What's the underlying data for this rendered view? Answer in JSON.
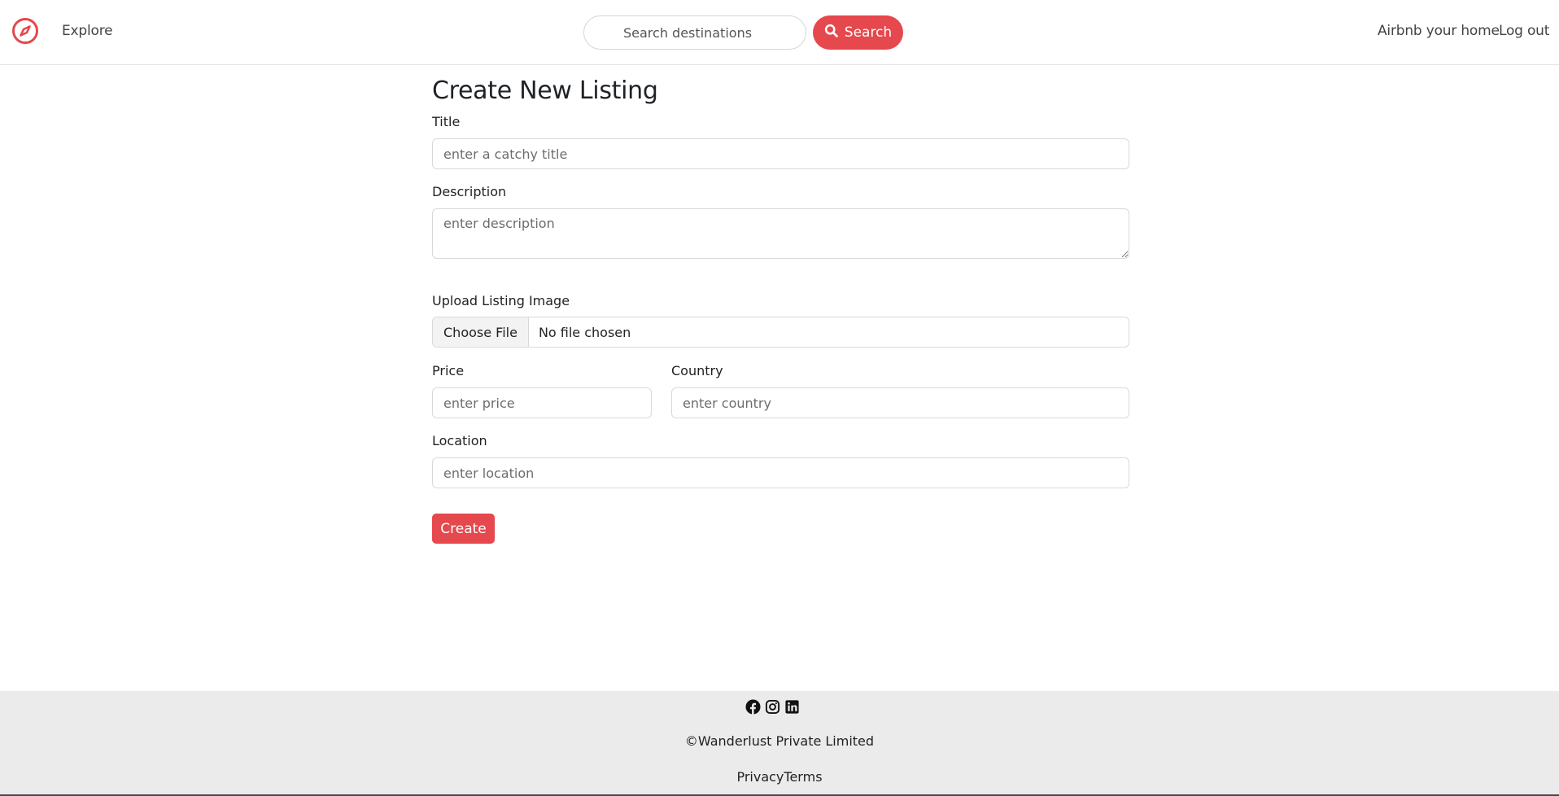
{
  "navbar": {
    "explore_label": "Explore",
    "search_placeholder": "Search destinations",
    "search_button_label": "Search",
    "host_label": "Airbnb your home",
    "logout_label": "Log out"
  },
  "form": {
    "heading": "Create New Listing",
    "title_label": "Title",
    "title_placeholder": "enter a catchy title",
    "description_label": "Description",
    "description_placeholder": "enter description",
    "image_label": "Upload Listing Image",
    "choose_file_label": "Choose File",
    "file_status": "No file chosen",
    "price_label": "Price",
    "price_placeholder": "enter price",
    "country_label": "Country",
    "country_placeholder": "enter country",
    "location_label": "Location",
    "location_placeholder": "enter location",
    "submit_label": "Create"
  },
  "footer": {
    "social_icons": [
      "facebook-icon",
      "instagram-icon",
      "linkedin-icon"
    ],
    "copyright": "©Wanderlust Private Limited",
    "privacy_label": "Privacy",
    "terms_label": "Terms"
  },
  "colors": {
    "accent": "#e5484d",
    "footer_bg": "#ebebeb"
  }
}
